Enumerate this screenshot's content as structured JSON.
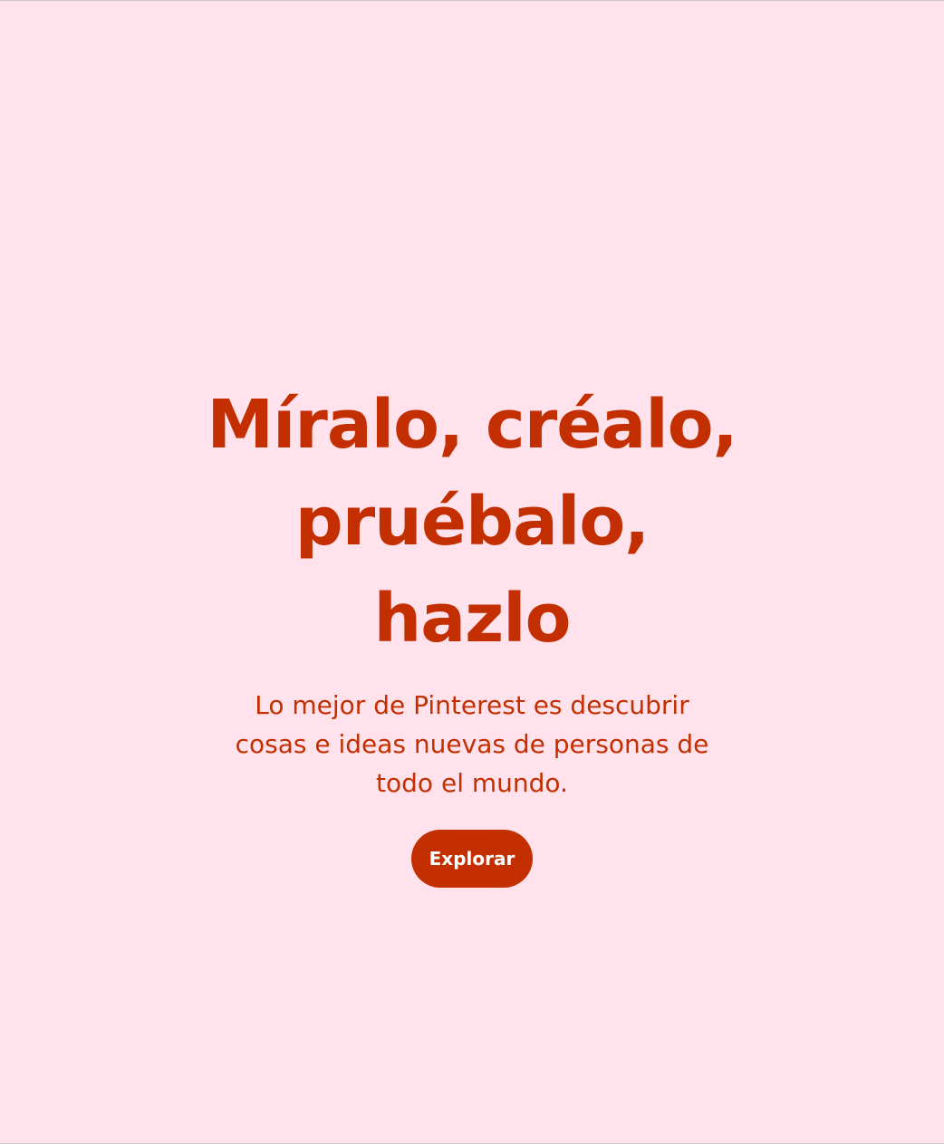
{
  "hero": {
    "headline_lines": [
      "Míralo, créalo,",
      "pruébalo,",
      "hazlo"
    ],
    "subtext": "Lo mejor de Pinterest es descubrir cosas e ideas nuevas de personas de todo el mundo.",
    "explore_label": "Explorar"
  },
  "colors": {
    "background": "#ffe2ec",
    "accent": "#c32f00",
    "button_text": "#ffffff"
  }
}
